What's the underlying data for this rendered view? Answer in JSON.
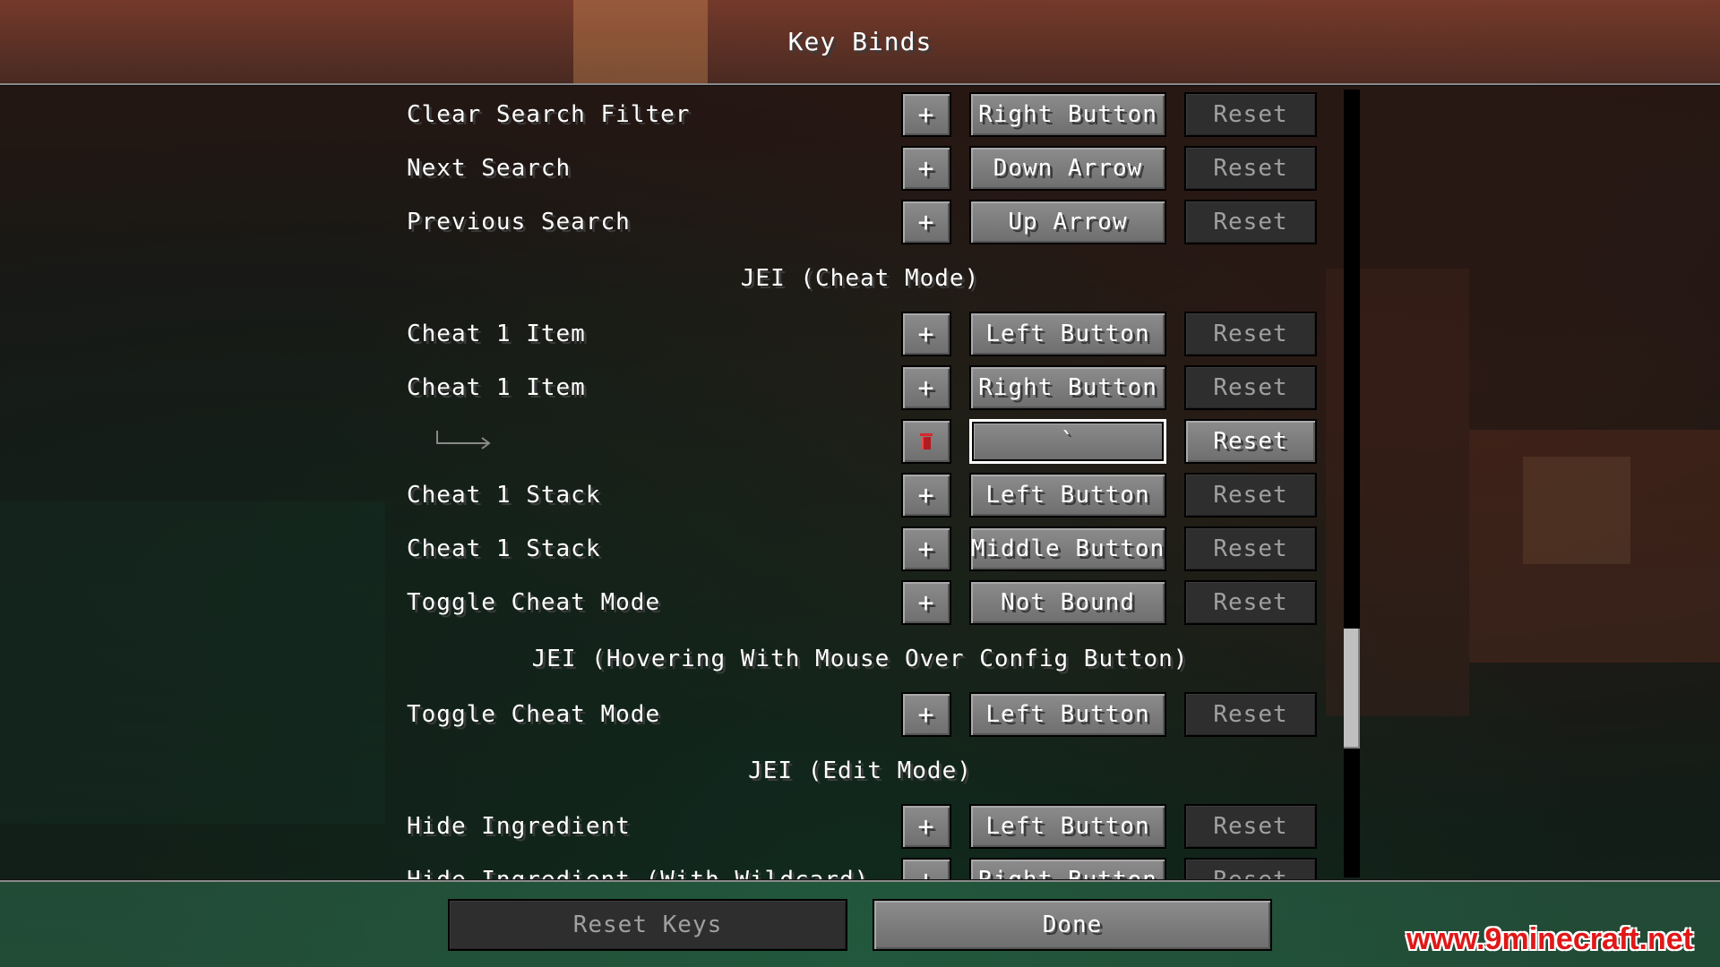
{
  "title": "Key Binds",
  "icons": {
    "plus": "+",
    "trash": "trash-icon",
    "sub_arrow": "sub-binding-arrow-icon"
  },
  "colors": {
    "text": "#ffffff",
    "disabled_text": "#a0a0a0",
    "trash": "#d9262c",
    "watermark": "#e01818"
  },
  "rows": [
    {
      "label": "Clear Search Filter",
      "plus": "+",
      "key": "Right Button",
      "reset": "Reset"
    },
    {
      "label": "Next Search",
      "plus": "+",
      "key": "Down Arrow",
      "reset": "Reset"
    },
    {
      "label": "Previous Search",
      "plus": "+",
      "key": "Up Arrow",
      "reset": "Reset"
    },
    {
      "category": "JEI (Cheat Mode)"
    },
    {
      "label": "Cheat 1 Item",
      "plus": "+",
      "key": "Left Button",
      "reset": "Reset"
    },
    {
      "label": "Cheat 1 Item",
      "plus": "+",
      "key": "Right Button",
      "reset": "Reset"
    },
    {
      "key": "`",
      "reset": "Reset",
      "editing": true
    },
    {
      "label": "Cheat 1 Stack",
      "plus": "+",
      "key": "Left Button",
      "reset": "Reset"
    },
    {
      "label": "Cheat 1 Stack",
      "plus": "+",
      "key": "Middle Button",
      "reset": "Reset"
    },
    {
      "label": "Toggle Cheat Mode",
      "plus": "+",
      "key": "Not Bound",
      "reset": "Reset"
    },
    {
      "category": "JEI (Hovering With Mouse Over Config Button)"
    },
    {
      "label": "Toggle Cheat Mode",
      "plus": "+",
      "key": "Left Button",
      "reset": "Reset"
    },
    {
      "category": "JEI (Edit Mode)"
    },
    {
      "label": "Hide Ingredient",
      "plus": "+",
      "key": "Left Button",
      "reset": "Reset"
    },
    {
      "label": "Hide Ingredient (With Wildcard)",
      "plus": "+",
      "key": "Right Button",
      "reset": "Reset"
    }
  ],
  "footer": {
    "reset_keys": "Reset Keys",
    "done": "Done"
  },
  "watermark": "www.9minecraft.net"
}
